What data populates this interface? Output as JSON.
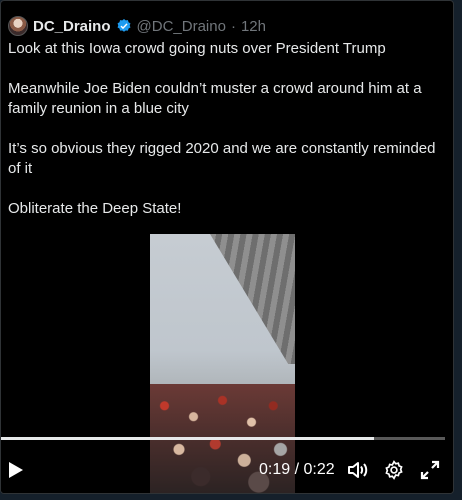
{
  "tweet": {
    "display_name": "DC_Draino",
    "handle": "@DC_Draino",
    "separator": "·",
    "time": "12h",
    "paragraphs": [
      "Look at this Iowa crowd going nuts over President Trump",
      "Meanwhile Joe Biden couldn’t muster a crowd around him at a family reunion in a blue city",
      "It’s so obvious they rigged 2020 and we are constantly reminded of it",
      "Obliterate the Deep State!"
    ]
  },
  "video": {
    "current_time": "0:19",
    "duration": "0:22",
    "time_separator": "/",
    "progress": 0.84
  },
  "icons": {
    "verified": "verified-badge-icon",
    "play": "play-icon",
    "volume": "volume-icon",
    "settings": "settings-icon",
    "fullscreen": "fullscreen-icon"
  },
  "colors": {
    "verified": "#1d9bf0",
    "muted_text": "#71767b",
    "text": "#e7e9ea"
  }
}
